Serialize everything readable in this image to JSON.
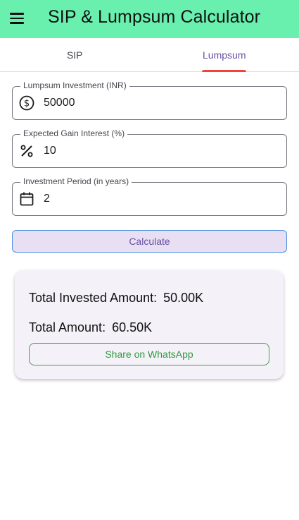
{
  "app": {
    "title": "SIP & Lumpsum Calculator",
    "bar_color": "#69f0ae"
  },
  "tabs": [
    {
      "label": "SIP",
      "active": false
    },
    {
      "label": "Lumpsum",
      "active": true
    }
  ],
  "form": {
    "investment": {
      "label": "Lumpsum Investment (INR)",
      "value": "50000",
      "icon": "dollar-circle-icon"
    },
    "interest": {
      "label": "Expected Gain Interest (%)",
      "value": "10",
      "icon": "percent-icon"
    },
    "period": {
      "label": "Investment Period (in years)",
      "value": "2",
      "icon": "calendar-icon"
    },
    "calculate_label": "Calculate"
  },
  "results": {
    "invested_label": "Total Invested Amount:",
    "invested_value": "50.00K",
    "total_label": "Total Amount:",
    "total_value": "60.50K",
    "share_label": "Share on WhatsApp"
  },
  "colors": {
    "accent": "#6750a4",
    "tab_indicator": "#f44336",
    "share_green": "#2e9a3a"
  }
}
